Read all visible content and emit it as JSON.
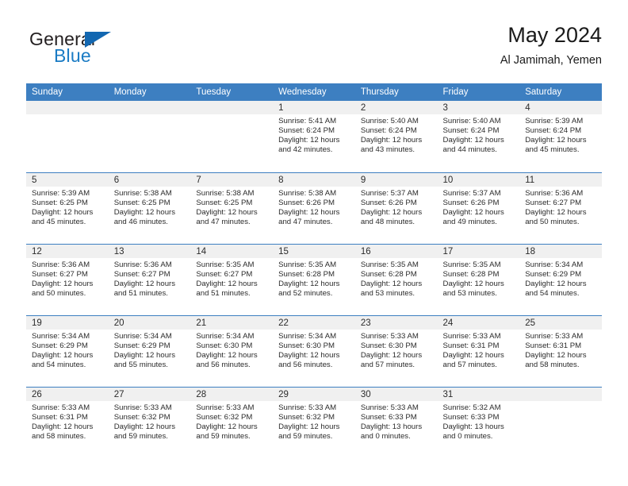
{
  "brand": {
    "name_top": "General",
    "name_bottom": "Blue",
    "triangle_color": "#1267b1",
    "top_color": "#231f20",
    "bottom_color": "#1a7bc4"
  },
  "header": {
    "title": "May 2024",
    "location": "Al Jamimah, Yemen"
  },
  "theme": {
    "header_bg": "#3d7fc1",
    "header_text": "#ffffff",
    "daynum_bg": "#f0f0f0",
    "grid_line": "#3d7fc1",
    "body_text": "#2b2b2b"
  },
  "weekday_headers": [
    "Sunday",
    "Monday",
    "Tuesday",
    "Wednesday",
    "Thursday",
    "Friday",
    "Saturday"
  ],
  "labels": {
    "sunrise_prefix": "Sunrise:",
    "sunset_prefix": "Sunset:",
    "daylight_prefix": "Daylight:"
  },
  "weeks": [
    [
      {
        "empty": true,
        "day": "",
        "sunrise": "",
        "sunset": "",
        "daylight": ""
      },
      {
        "empty": true,
        "day": "",
        "sunrise": "",
        "sunset": "",
        "daylight": ""
      },
      {
        "empty": true,
        "day": "",
        "sunrise": "",
        "sunset": "",
        "daylight": ""
      },
      {
        "empty": false,
        "day": "1",
        "sunrise": "Sunrise: 5:41 AM",
        "sunset": "Sunset: 6:24 PM",
        "daylight": "Daylight: 12 hours and 42 minutes."
      },
      {
        "empty": false,
        "day": "2",
        "sunrise": "Sunrise: 5:40 AM",
        "sunset": "Sunset: 6:24 PM",
        "daylight": "Daylight: 12 hours and 43 minutes."
      },
      {
        "empty": false,
        "day": "3",
        "sunrise": "Sunrise: 5:40 AM",
        "sunset": "Sunset: 6:24 PM",
        "daylight": "Daylight: 12 hours and 44 minutes."
      },
      {
        "empty": false,
        "day": "4",
        "sunrise": "Sunrise: 5:39 AM",
        "sunset": "Sunset: 6:24 PM",
        "daylight": "Daylight: 12 hours and 45 minutes."
      }
    ],
    [
      {
        "empty": false,
        "day": "5",
        "sunrise": "Sunrise: 5:39 AM",
        "sunset": "Sunset: 6:25 PM",
        "daylight": "Daylight: 12 hours and 45 minutes."
      },
      {
        "empty": false,
        "day": "6",
        "sunrise": "Sunrise: 5:38 AM",
        "sunset": "Sunset: 6:25 PM",
        "daylight": "Daylight: 12 hours and 46 minutes."
      },
      {
        "empty": false,
        "day": "7",
        "sunrise": "Sunrise: 5:38 AM",
        "sunset": "Sunset: 6:25 PM",
        "daylight": "Daylight: 12 hours and 47 minutes."
      },
      {
        "empty": false,
        "day": "8",
        "sunrise": "Sunrise: 5:38 AM",
        "sunset": "Sunset: 6:26 PM",
        "daylight": "Daylight: 12 hours and 47 minutes."
      },
      {
        "empty": false,
        "day": "9",
        "sunrise": "Sunrise: 5:37 AM",
        "sunset": "Sunset: 6:26 PM",
        "daylight": "Daylight: 12 hours and 48 minutes."
      },
      {
        "empty": false,
        "day": "10",
        "sunrise": "Sunrise: 5:37 AM",
        "sunset": "Sunset: 6:26 PM",
        "daylight": "Daylight: 12 hours and 49 minutes."
      },
      {
        "empty": false,
        "day": "11",
        "sunrise": "Sunrise: 5:36 AM",
        "sunset": "Sunset: 6:27 PM",
        "daylight": "Daylight: 12 hours and 50 minutes."
      }
    ],
    [
      {
        "empty": false,
        "day": "12",
        "sunrise": "Sunrise: 5:36 AM",
        "sunset": "Sunset: 6:27 PM",
        "daylight": "Daylight: 12 hours and 50 minutes."
      },
      {
        "empty": false,
        "day": "13",
        "sunrise": "Sunrise: 5:36 AM",
        "sunset": "Sunset: 6:27 PM",
        "daylight": "Daylight: 12 hours and 51 minutes."
      },
      {
        "empty": false,
        "day": "14",
        "sunrise": "Sunrise: 5:35 AM",
        "sunset": "Sunset: 6:27 PM",
        "daylight": "Daylight: 12 hours and 51 minutes."
      },
      {
        "empty": false,
        "day": "15",
        "sunrise": "Sunrise: 5:35 AM",
        "sunset": "Sunset: 6:28 PM",
        "daylight": "Daylight: 12 hours and 52 minutes."
      },
      {
        "empty": false,
        "day": "16",
        "sunrise": "Sunrise: 5:35 AM",
        "sunset": "Sunset: 6:28 PM",
        "daylight": "Daylight: 12 hours and 53 minutes."
      },
      {
        "empty": false,
        "day": "17",
        "sunrise": "Sunrise: 5:35 AM",
        "sunset": "Sunset: 6:28 PM",
        "daylight": "Daylight: 12 hours and 53 minutes."
      },
      {
        "empty": false,
        "day": "18",
        "sunrise": "Sunrise: 5:34 AM",
        "sunset": "Sunset: 6:29 PM",
        "daylight": "Daylight: 12 hours and 54 minutes."
      }
    ],
    [
      {
        "empty": false,
        "day": "19",
        "sunrise": "Sunrise: 5:34 AM",
        "sunset": "Sunset: 6:29 PM",
        "daylight": "Daylight: 12 hours and 54 minutes."
      },
      {
        "empty": false,
        "day": "20",
        "sunrise": "Sunrise: 5:34 AM",
        "sunset": "Sunset: 6:29 PM",
        "daylight": "Daylight: 12 hours and 55 minutes."
      },
      {
        "empty": false,
        "day": "21",
        "sunrise": "Sunrise: 5:34 AM",
        "sunset": "Sunset: 6:30 PM",
        "daylight": "Daylight: 12 hours and 56 minutes."
      },
      {
        "empty": false,
        "day": "22",
        "sunrise": "Sunrise: 5:34 AM",
        "sunset": "Sunset: 6:30 PM",
        "daylight": "Daylight: 12 hours and 56 minutes."
      },
      {
        "empty": false,
        "day": "23",
        "sunrise": "Sunrise: 5:33 AM",
        "sunset": "Sunset: 6:30 PM",
        "daylight": "Daylight: 12 hours and 57 minutes."
      },
      {
        "empty": false,
        "day": "24",
        "sunrise": "Sunrise: 5:33 AM",
        "sunset": "Sunset: 6:31 PM",
        "daylight": "Daylight: 12 hours and 57 minutes."
      },
      {
        "empty": false,
        "day": "25",
        "sunrise": "Sunrise: 5:33 AM",
        "sunset": "Sunset: 6:31 PM",
        "daylight": "Daylight: 12 hours and 58 minutes."
      }
    ],
    [
      {
        "empty": false,
        "day": "26",
        "sunrise": "Sunrise: 5:33 AM",
        "sunset": "Sunset: 6:31 PM",
        "daylight": "Daylight: 12 hours and 58 minutes."
      },
      {
        "empty": false,
        "day": "27",
        "sunrise": "Sunrise: 5:33 AM",
        "sunset": "Sunset: 6:32 PM",
        "daylight": "Daylight: 12 hours and 59 minutes."
      },
      {
        "empty": false,
        "day": "28",
        "sunrise": "Sunrise: 5:33 AM",
        "sunset": "Sunset: 6:32 PM",
        "daylight": "Daylight: 12 hours and 59 minutes."
      },
      {
        "empty": false,
        "day": "29",
        "sunrise": "Sunrise: 5:33 AM",
        "sunset": "Sunset: 6:32 PM",
        "daylight": "Daylight: 12 hours and 59 minutes."
      },
      {
        "empty": false,
        "day": "30",
        "sunrise": "Sunrise: 5:33 AM",
        "sunset": "Sunset: 6:33 PM",
        "daylight": "Daylight: 13 hours and 0 minutes."
      },
      {
        "empty": false,
        "day": "31",
        "sunrise": "Sunrise: 5:32 AM",
        "sunset": "Sunset: 6:33 PM",
        "daylight": "Daylight: 13 hours and 0 minutes."
      },
      {
        "empty": true,
        "day": "",
        "sunrise": "",
        "sunset": "",
        "daylight": ""
      }
    ]
  ]
}
